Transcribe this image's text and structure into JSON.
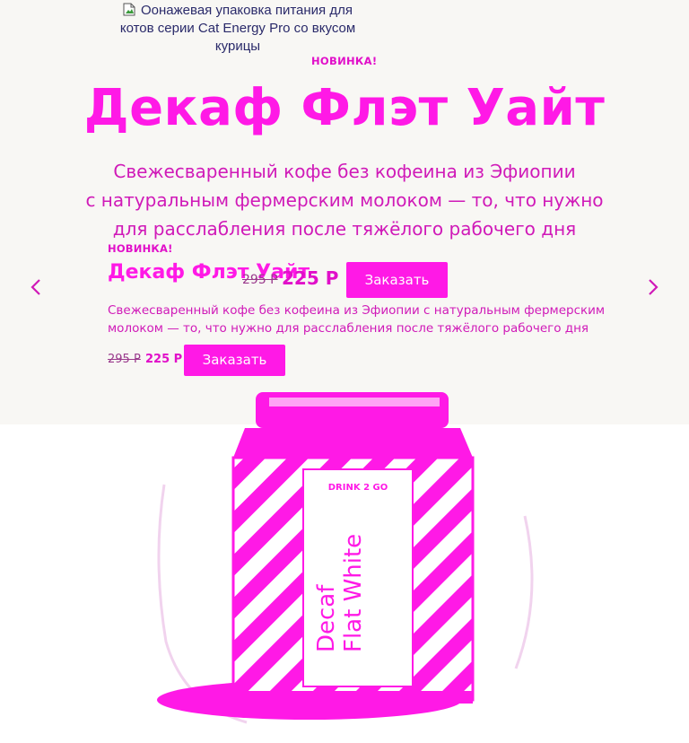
{
  "broken_image": {
    "alt_text": "Оонажевая упаковка питания для котов серии Cat Energy Pro со вкусом курицы",
    "icon": "broken-image-icon"
  },
  "hero": {
    "badge": "НОВИНКА!",
    "title": "Декаф Флэт Уайт",
    "description_lines": [
      "Свежесваренный кофе без кофеина из Эфиопии",
      "с натуральным фермерским молоком — то, что нужно",
      "для расслабления после тяжёлого рабочего дня"
    ]
  },
  "slide": {
    "badge": "НОВИНКА!",
    "title": "Декаф Флэт Уайт",
    "old_price": "295 Р",
    "new_price": "225 Р",
    "order_label": "Заказать",
    "description": "Свежесваренный кофе без кофеина из Эфиопии с натуральным фермерским молоком — то, что нужно для расслабления после тяжёлого рабочего дня",
    "small_old_price": "295 Р",
    "small_new_price": "225 Р",
    "small_order_label": "Заказать"
  },
  "navigation": {
    "prev_icon": "chevron-left-icon",
    "next_icon": "chevron-right-icon"
  },
  "product_can": {
    "brand": "DRINK 2 GO",
    "label_line_1": "Decaf",
    "label_line_2": "Flat White"
  },
  "colors": {
    "accent": "#ff19e6",
    "hero_background": "#f8f7f4",
    "page_background": "#ffffff"
  }
}
